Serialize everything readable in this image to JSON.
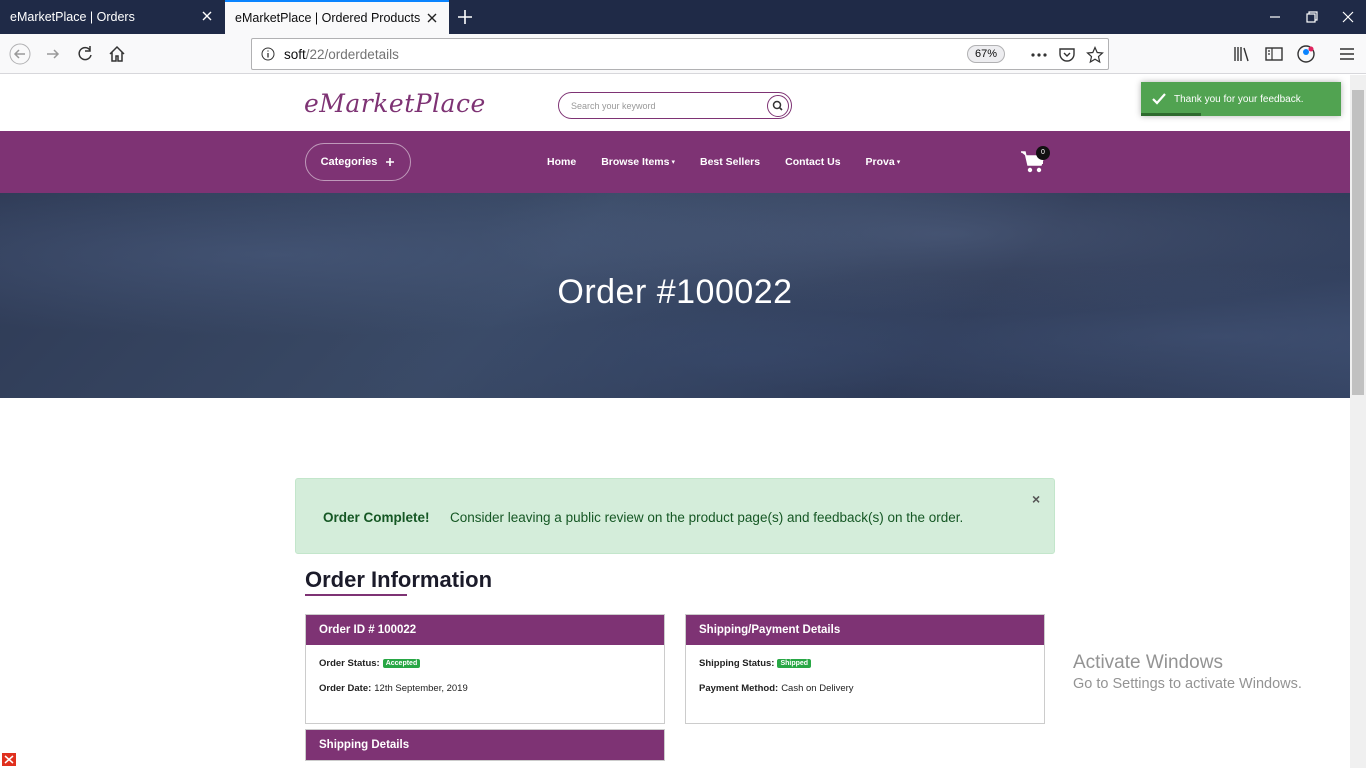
{
  "browser": {
    "tabs": [
      {
        "title": "eMarketPlace | Orders",
        "active": false
      },
      {
        "title": "eMarketPlace | Ordered Products",
        "active": true
      }
    ],
    "url_host": "soft",
    "url_path": "/22/orderdetails",
    "zoom": "67%"
  },
  "site": {
    "logo": "eMarketPlace",
    "search_placeholder": "Search your keyword",
    "categories_label": "Categories",
    "nav": [
      {
        "label": "Home",
        "dropdown": false
      },
      {
        "label": "Browse Items",
        "dropdown": true
      },
      {
        "label": "Best Sellers",
        "dropdown": false
      },
      {
        "label": "Contact Us",
        "dropdown": false
      },
      {
        "label": "Prova",
        "dropdown": true
      }
    ],
    "cart_count": "0",
    "accent_color": "#7e3374"
  },
  "hero": {
    "title": "Order #100022"
  },
  "alert": {
    "strong": "Order Complete!",
    "text": "Consider leaving a public review on the product page(s) and feedback(s) on the order.",
    "close": "×"
  },
  "order_info": {
    "title": "Order Information",
    "order_card": {
      "title": "Order ID # 100022",
      "status_label": "Order Status:",
      "status_value": "Accepted",
      "date_label": "Order Date:",
      "date_value": "12th September, 2019"
    },
    "shipping_payment_card": {
      "title": "Shipping/Payment Details",
      "shipping_status_label": "Shipping Status:",
      "shipping_status_value": "Shipped",
      "payment_label": "Payment Method:",
      "payment_value": "Cash on Delivery"
    },
    "shipping_details_card": {
      "title": "Shipping Details"
    }
  },
  "toast": {
    "text": "Thank you for your feedback.",
    "progress": 0.3
  },
  "watermark": {
    "line1": "Activate Windows",
    "line2": "Go to Settings to activate Windows."
  }
}
